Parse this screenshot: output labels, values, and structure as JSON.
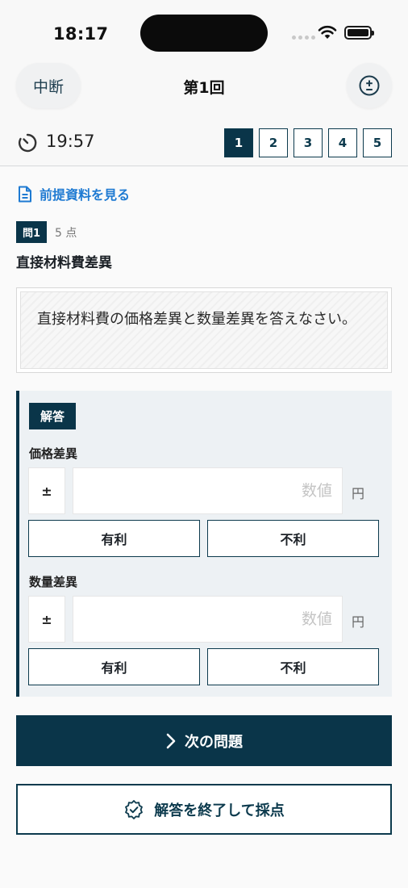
{
  "status_bar": {
    "time": "18:17"
  },
  "nav": {
    "pause_label": "中断",
    "title": "第1回",
    "calculator_icon": "plus-minus-icon"
  },
  "timer": {
    "text": "19:57"
  },
  "pager": {
    "pages": [
      "1",
      "2",
      "3",
      "4",
      "5"
    ],
    "active": "1"
  },
  "reference_link": {
    "label": "前提資料を見る"
  },
  "question": {
    "number_label": "問1",
    "points": "5 点",
    "title": "直接材料費差異",
    "body": "直接材料費の価格差異と数量差異を答えなさい。"
  },
  "answer": {
    "label": "解答",
    "fields": [
      {
        "label": "価格差異",
        "sign": "±",
        "placeholder": "数値",
        "unit": "円",
        "options": [
          "有利",
          "不利"
        ]
      },
      {
        "label": "数量差異",
        "sign": "±",
        "placeholder": "数値",
        "unit": "円",
        "options": [
          "有利",
          "不利"
        ]
      }
    ]
  },
  "buttons": {
    "next_label": "次の問題",
    "finish_label": "解答を終了して採点"
  },
  "colors": {
    "primary": "#0a3549",
    "link": "#1e7ad2",
    "panel": "#edf1f4"
  }
}
